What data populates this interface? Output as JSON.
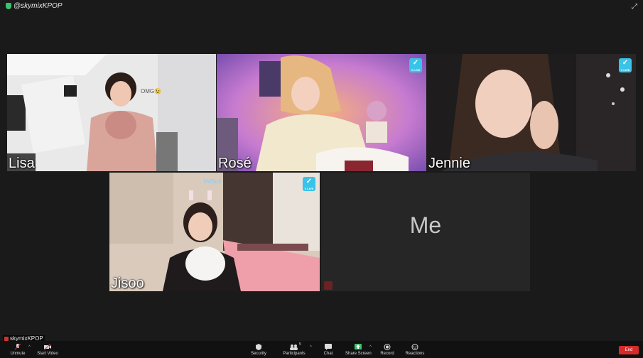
{
  "header": {
    "watermark": "@skymixKPOP"
  },
  "participants": [
    {
      "name": "Lisa"
    },
    {
      "name": "Rosé"
    },
    {
      "name": "Jennie"
    },
    {
      "name": "Jisoo"
    }
  ],
  "self_tile": {
    "label": "Me"
  },
  "lisa_tile": {
    "sign": "OMG😉"
  },
  "jisoo_tile": {
    "watermark": "VidSub"
  },
  "vlive_badge": "V LIVE",
  "footer": {
    "self_name": "skymixKPOP",
    "unmute": "Unmute",
    "start_video": "Start Video",
    "security": "Security",
    "participants": "Participants",
    "participants_count": "5",
    "chat": "Chat",
    "share_screen": "Share Screen",
    "record": "Record",
    "reactions": "Reactions",
    "end": "End"
  },
  "colors": {
    "end": "#d62b2b",
    "share": "#3cc26a",
    "vlive": "#39c3e8"
  }
}
